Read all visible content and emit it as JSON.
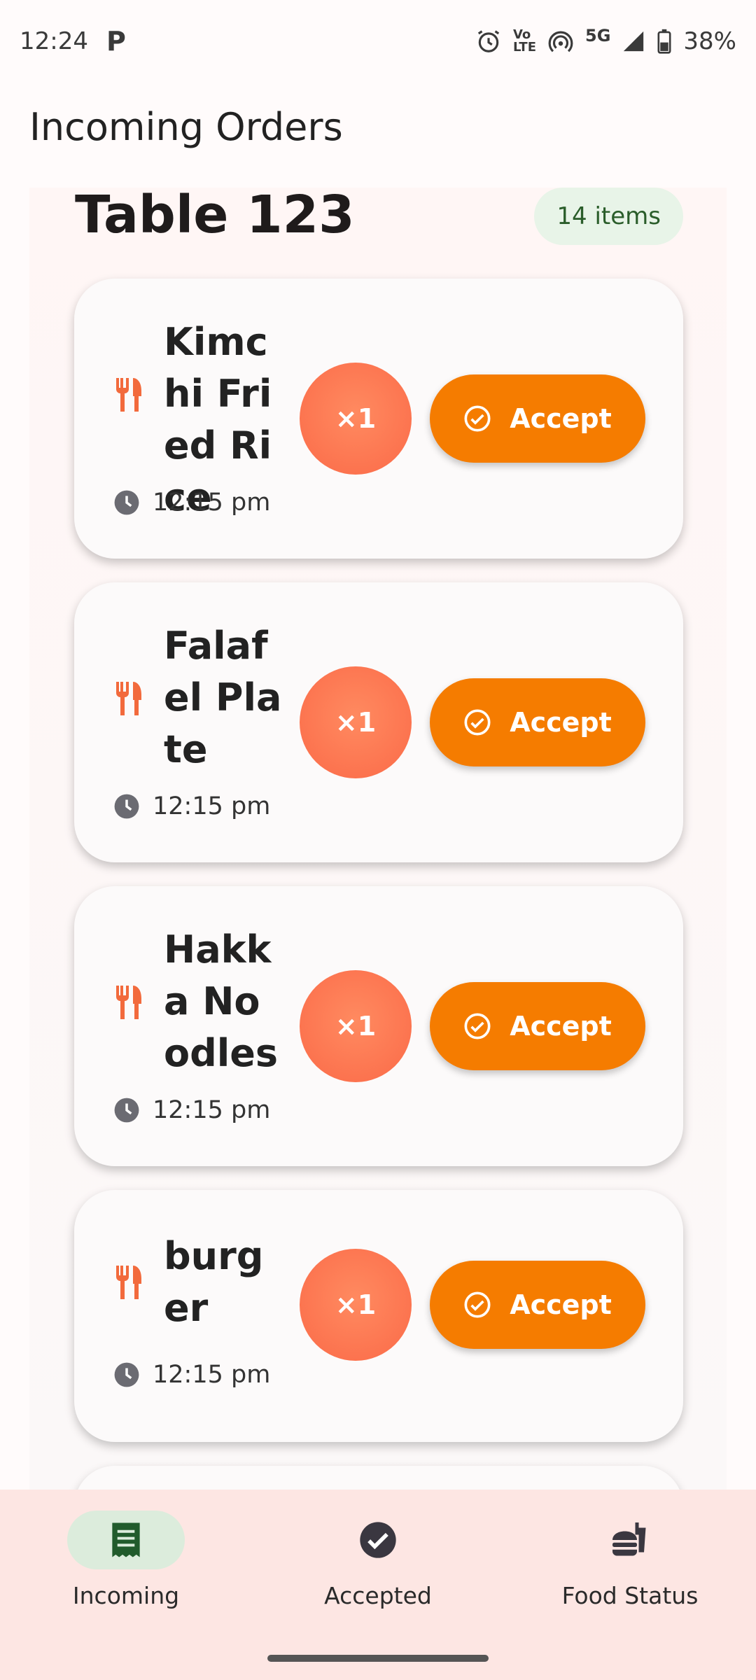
{
  "status_bar": {
    "time": "12:24",
    "carrier_badge": "P",
    "network": "5G",
    "battery": "38%",
    "icons": [
      "alarm-icon",
      "volte-icon",
      "hotspot-icon",
      "signal-icon",
      "battery-icon"
    ]
  },
  "header": {
    "title": "Incoming Orders"
  },
  "table": {
    "title": "Table 123",
    "items_badge": "14 items"
  },
  "orders": [
    {
      "name": "Kimchi Fried Rice",
      "time": "12:15 pm",
      "qty": "×1",
      "accept_label": "Accept"
    },
    {
      "name": "Falafel Plate",
      "time": "12:15 pm",
      "qty": "×1",
      "accept_label": "Accept"
    },
    {
      "name": "Hakka Noodles",
      "time": "12:15 pm",
      "qty": "×1",
      "accept_label": "Accept"
    },
    {
      "name": "burger",
      "time": "12:15 pm",
      "qty": "×1",
      "accept_label": "Accept"
    }
  ],
  "bottom_nav": {
    "items": [
      {
        "label": "Incoming",
        "icon": "receipt-icon",
        "active": true
      },
      {
        "label": "Accepted",
        "icon": "check-circle-icon",
        "active": false
      },
      {
        "label": "Food Status",
        "icon": "food-icon",
        "active": false
      }
    ]
  },
  "colors": {
    "accent_orange": "#f57c00",
    "qty_orange": "#fb6a48",
    "nav_background": "#fde6e3",
    "active_pill": "#dcecdc"
  }
}
